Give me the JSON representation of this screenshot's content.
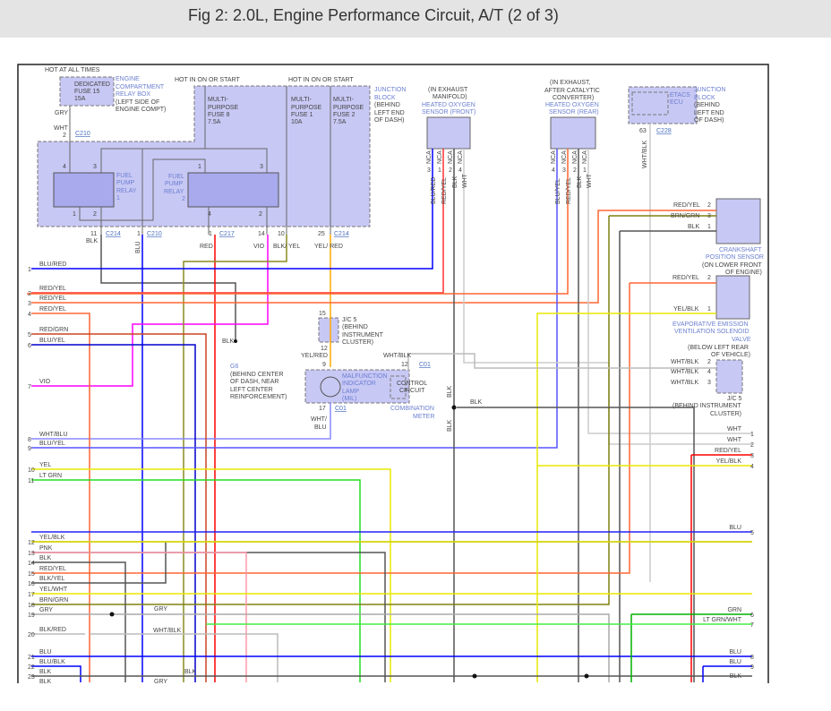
{
  "title": "Fig 2: 2.0L, Engine Performance Circuit, A/T (2 of 3)",
  "colors": {
    "BLU": "#0000ff",
    "RED": "#ff0000",
    "REDYEL": "#ff5a33",
    "YEL": "#e8e800",
    "GRN": "#00c000",
    "LTGRN": "#33ee33",
    "VIO": "#ff00ff",
    "BLK": "#555555",
    "WHT": "#cccccc",
    "GRY": "#aaaaaa",
    "PNK": "#ff99aa",
    "BRNGRN": "#7f7f10",
    "YELRED": "#ffaa00",
    "fill": "#c8c8f5"
  },
  "power": {
    "hot_all": "HOT AT ALL TIMES",
    "hot_on1": "HOT IN ON OR START",
    "hot_on2": "HOT IN ON OR START"
  },
  "relay_box": {
    "fuse": [
      "DEDICATED",
      "FUSE 15",
      "15A"
    ],
    "label": [
      "ENGINE",
      "COMPARTMENT",
      "RELAY BOX"
    ],
    "loc": [
      "(LEFT SIDE OF",
      "ENGINE COMPT)"
    ],
    "gry": "GRY",
    "wht": "WHT",
    "pin": "2",
    "conn": "C210"
  },
  "junction_block": {
    "fuses": [
      [
        "MULTI-",
        "PURPOSE",
        "FUSE 8",
        "7.5A"
      ],
      [
        "MULTI-",
        "PURPOSE",
        "FUSE 1",
        "10A"
      ],
      [
        "MULTI-",
        "PURPOSE",
        "FUSE 2",
        "7.5A"
      ]
    ],
    "label": [
      "JUNCTION",
      "BLOCK"
    ],
    "loc": [
      "(BEHIND",
      "LEFT END",
      "OF DASH)"
    ]
  },
  "relay1": {
    "name": [
      "FUEL",
      "PUMP",
      "RELAY",
      "1"
    ],
    "pins": [
      "4",
      "3",
      "1",
      "2"
    ]
  },
  "relay2": {
    "name": [
      "FUEL",
      "PUMP",
      "RELAY",
      "2"
    ],
    "pins": [
      "1",
      "3",
      "4",
      "2"
    ]
  },
  "outputs": [
    {
      "pin": "11",
      "conn": "C214",
      "wire": "BLK"
    },
    {
      "pin": "1",
      "conn": "C210",
      "wire": "BLU"
    },
    {
      "pin": "1",
      "conn": "C217",
      "wire": "RED"
    },
    {
      "pin": "14",
      "wire": "VIO"
    },
    {
      "pin": "10",
      "wire": "BLK/ YEL"
    },
    {
      "pin": "25",
      "conn": "C214",
      "wire": "YEL/ RED"
    }
  ],
  "o2_front": {
    "loc": [
      "(IN EXHAUST",
      "MANIFOLD)"
    ],
    "name": [
      "HEATED OXYGEN",
      "SENSOR (FRONT)"
    ],
    "pins": [
      "3",
      "1",
      "2",
      "4"
    ],
    "wires": [
      "BLU/RED",
      "RED/YEL",
      "BLK",
      "WHT"
    ],
    "nca": "NCA"
  },
  "o2_rear": {
    "loc": [
      "(IN EXHAUST,",
      "AFTER CATALYTIC",
      "CONVERTER)"
    ],
    "name": [
      "HEATED OXYGEN",
      "SENSOR (REAR)"
    ],
    "pins": [
      "4",
      "3",
      "2",
      "1"
    ],
    "wires": [
      "BLU/YEL",
      "RED/YEL",
      "BLK",
      "WHT"
    ],
    "nca": "NCA"
  },
  "etacs": {
    "name": [
      "ETACS",
      "ECU"
    ],
    "label": [
      "JUNCTION",
      "BLOCK"
    ],
    "loc": [
      "(BEHIND",
      "LEFT END",
      "OF DASH)"
    ],
    "pin": "63",
    "conn": "C228",
    "wire": "WHT/BLK"
  },
  "crank": {
    "wires": [
      {
        "w": "RED/YEL",
        "p": "2"
      },
      {
        "w": "BRN/GRN",
        "p": "3"
      },
      {
        "w": "BLK",
        "p": "1"
      }
    ],
    "name": [
      "CRANKSHAFT",
      "POSITION SENSOR"
    ],
    "loc": [
      "(ON LOWER FRONT",
      "OF ENGINE)"
    ]
  },
  "evap": {
    "wires": [
      {
        "w": "RED/YEL",
        "p": "2"
      },
      {
        "w": "YEL/BLK",
        "p": "1"
      }
    ],
    "name": [
      "EVAPORATIVE EMISSION",
      "VENTILATION SOLENOID",
      "VALVE"
    ],
    "loc": [
      "(BELOW LEFT REAR",
      "OF VEHICLE)"
    ]
  },
  "jc5_right": {
    "wires": [
      {
        "w": "WHT/BLK",
        "p": "2"
      },
      {
        "w": "WHT/BLK",
        "p": "4"
      },
      {
        "w": "WHT/BLK",
        "p": "3"
      }
    ],
    "name": "J/C 5",
    "loc": [
      "(BEHIND INSTRUMENT",
      "CLUSTER)"
    ]
  },
  "jc5_mid": {
    "pin_top": "15",
    "pin_bot": "12",
    "name": "J/C 5",
    "loc": [
      "(BEHIND",
      "INSTRUMENT",
      "CLUSTER)"
    ],
    "wire": "YEL/RED"
  },
  "meter": {
    "pin_in": "9",
    "pin_ctrl": "12",
    "conn": "C01",
    "pin_out": "17",
    "conn2": "C01",
    "ctrl_wire": "WHT/BLK",
    "out_wire": [
      "WHT/",
      "BLU"
    ],
    "mil": [
      "MALFUNCTION",
      "INDICATOR",
      "LAMP",
      "(MIL)"
    ],
    "control": [
      "CONTROL",
      "CIRCUIT"
    ],
    "name": [
      "COMBINATION",
      "METER"
    ]
  },
  "ground": {
    "wire": "BLK",
    "name": "G6",
    "loc": [
      "(BEHIND CENTER",
      "OF DASH, NEAR",
      "LEFT CENTER",
      "REINFORCEMENT)"
    ]
  },
  "splice": {
    "blk_v1": "BLK",
    "blk_v2": "BLK",
    "blk_h": "BLK"
  },
  "left_rows": [
    {
      "n": "1",
      "w": "BLU/RED"
    },
    {
      "n": "2",
      "w": "RED/YEL"
    },
    {
      "n": "3",
      "w": "RED/YEL"
    },
    {
      "n": "4",
      "w": "RED/YEL"
    },
    {
      "n": "5",
      "w": "RED/GRN"
    },
    {
      "n": "6",
      "w": "BLU/YEL"
    },
    {
      "n": "7",
      "w": "VIO"
    },
    {
      "n": "8",
      "w": "WHT/BLU"
    },
    {
      "n": "9",
      "w": "BLU/YEL"
    },
    {
      "n": "10",
      "w": "YEL"
    },
    {
      "n": "11",
      "w": "LT GRN"
    },
    {
      "n": "12",
      "w": "YEL/BLK"
    },
    {
      "n": "13",
      "w": "PNK"
    },
    {
      "n": "14",
      "w": "BLK"
    },
    {
      "n": "15",
      "w": "RED/YEL"
    },
    {
      "n": "16",
      "w": "BLK/YEL"
    },
    {
      "n": "17",
      "w": "YEL/WHT"
    },
    {
      "n": "18",
      "w": "BRN/GRN"
    },
    {
      "n": "19",
      "w": "GRY"
    },
    {
      "n": "20",
      "w": "BLK/RED"
    },
    {
      "n": "21",
      "w": "BLU"
    },
    {
      "n": "22",
      "w": "BLU/BLK"
    },
    {
      "n": "23",
      "w": "BLK"
    },
    {
      "n": "",
      "w": "BLK"
    }
  ],
  "right_rows": [
    {
      "n": "1",
      "w": "WHT"
    },
    {
      "n": "2",
      "w": "WHT"
    },
    {
      "n": "3",
      "w": "RED/YEL"
    },
    {
      "n": "4",
      "w": "YEL/BLK"
    },
    {
      "n": "5",
      "w": "BLU"
    },
    {
      "n": "6",
      "w": "GRN"
    },
    {
      "n": "7",
      "w": "LT GRN/WHT"
    },
    {
      "n": "8",
      "w": "BLU"
    },
    {
      "n": "9",
      "w": "BLU"
    },
    {
      "n": "",
      "w": "BLK"
    }
  ],
  "mid_labels": {
    "gry1": "GRY",
    "whtblk": "WHT/BLK",
    "blk": "BLK",
    "gry2": "GRY"
  }
}
